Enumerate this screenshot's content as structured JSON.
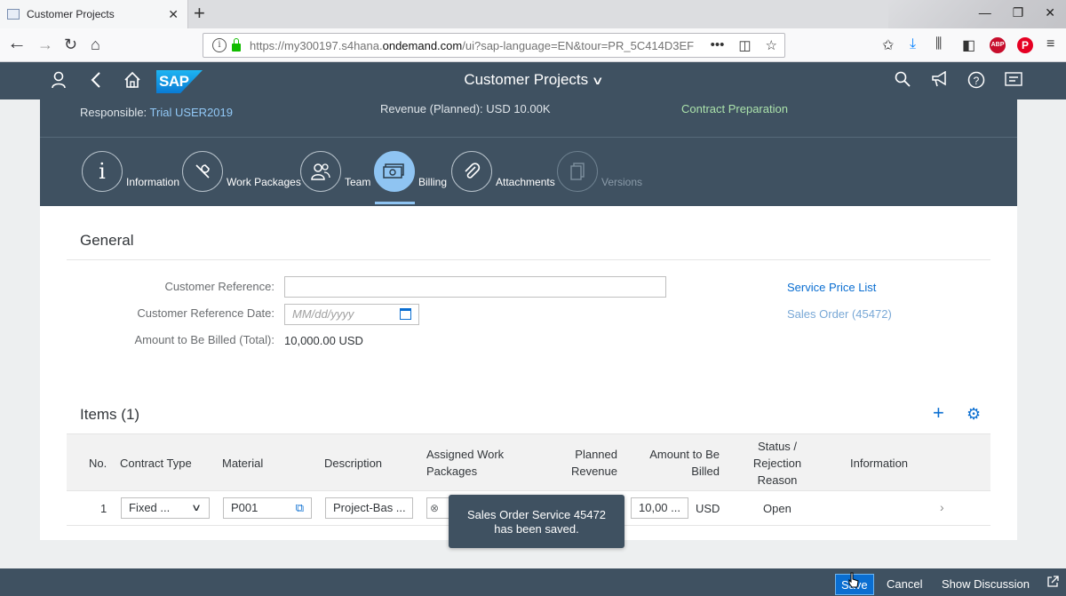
{
  "browser": {
    "tab_title": "Customer Projects",
    "tab_close": "✕",
    "new_tab": "+",
    "url_prefix": "https://my300197.s4hana.",
    "url_domain": "ondemand.com",
    "url_suffix": "/ui?sap-language=EN&tour=PR_5C414D3EF",
    "more_actions": "•••",
    "abp_badge": "ABP",
    "pinterest_badge": "P"
  },
  "shell": {
    "title": "Customer Projects",
    "logo": "SAP"
  },
  "header": {
    "responsible_label": "Responsible:",
    "responsible_value": "Trial USER2019",
    "revenue_label": "Revenue (Planned):",
    "revenue_value": "USD 10.00K",
    "status": "Contract Preparation",
    "anchors": [
      {
        "label": "Information",
        "icon": "info-icon"
      },
      {
        "label": "Work Packages",
        "icon": "wrench-icon"
      },
      {
        "label": "Team",
        "icon": "team-icon"
      },
      {
        "label": "Billing",
        "icon": "money-bills-icon"
      },
      {
        "label": "Attachments",
        "icon": "paperclip-icon"
      },
      {
        "label": "Versions",
        "icon": "versions-icon"
      }
    ]
  },
  "general": {
    "title": "General",
    "customer_reference_label": "Customer Reference:",
    "customer_reference_value": "",
    "customer_reference_date_label": "Customer Reference Date:",
    "date_placeholder": "MM/dd/yyyy",
    "amount_label": "Amount to Be Billed (Total):",
    "amount_value": "10,000.00 USD",
    "service_price_list_link": "Service Price List",
    "sales_order_link": "Sales Order (45472)"
  },
  "items": {
    "title": "Items (1)",
    "columns": [
      "No.",
      "Contract Type",
      "Material",
      "Description",
      "Assigned Work Packages",
      "Planned Revenue",
      "Amount to Be Billed",
      "Status / Rejection Reason",
      "Information"
    ],
    "rows": [
      {
        "no": "1",
        "contract_type": "Fixed ...",
        "material": "P001",
        "description": "Project-Bas ...",
        "amount": "10,00 ...",
        "currency": "USD",
        "status": "Open"
      }
    ]
  },
  "toast": {
    "line1": "Sales Order Service 45472",
    "line2": "has been saved."
  },
  "footer": {
    "save": "Save",
    "cancel": "Cancel",
    "show_discussion": "Show Discussion"
  },
  "colors": {
    "shell": "#3f5161",
    "accent": "#0a6ed1",
    "active_anchor": "#8fc4f2",
    "status_green": "#abe2ab"
  }
}
